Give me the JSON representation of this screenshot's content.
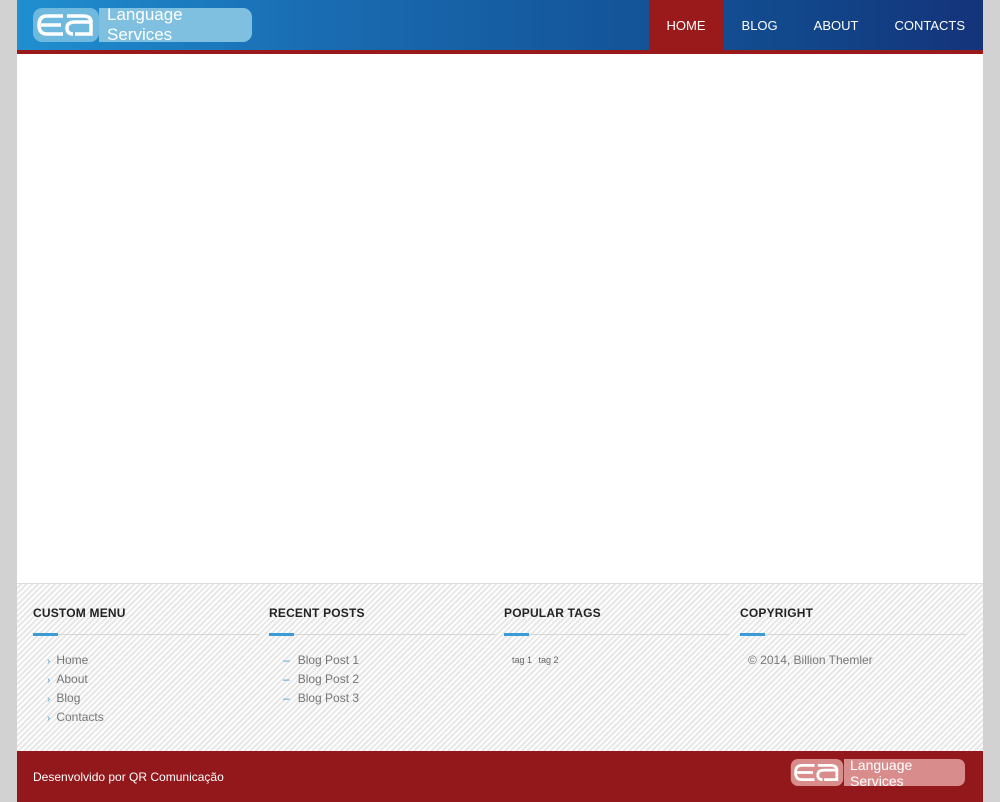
{
  "header": {
    "logo_text": "Language Services",
    "nav": [
      {
        "label": "HOME",
        "active": true
      },
      {
        "label": "BLOG",
        "active": false
      },
      {
        "label": "ABOUT",
        "active": false
      },
      {
        "label": "CONTACTS",
        "active": false
      }
    ]
  },
  "footer": {
    "custom_menu": {
      "title": "CUSTOM MENU",
      "items": [
        "Home",
        "About",
        "Blog",
        "Contacts"
      ]
    },
    "recent_posts": {
      "title": "RECENT POSTS",
      "items": [
        "Blog Post 1",
        "Blog Post 2",
        "Blog Post 3"
      ]
    },
    "popular_tags": {
      "title": "POPULAR TAGS",
      "tags": [
        "tag 1",
        "tag 2"
      ]
    },
    "copyright": {
      "title": "COPYRIGHT",
      "text": "© 2014, Billion Themler"
    }
  },
  "bottom_bar": {
    "credit": "Desenvolvido por QR Comunicação",
    "logo_text": "Language Services"
  },
  "colors": {
    "header_accent": "#9a1a1c",
    "bottom_bar": "#92181b",
    "link_accent": "#3a9bd6"
  }
}
